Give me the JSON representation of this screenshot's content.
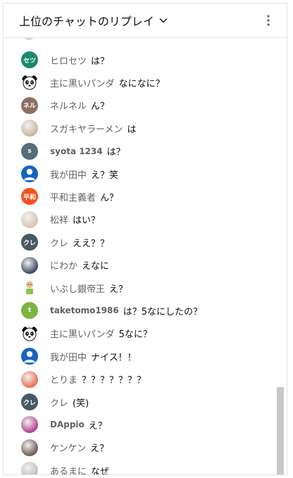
{
  "header": {
    "title": "上位のチャットのリプレイ"
  },
  "messages": [
    {
      "author": "ヒロセツ",
      "text": "は？",
      "avatar": {
        "kind": "initials",
        "label": "セツ",
        "color": "#1a8a6c"
      }
    },
    {
      "author": "主に黒いパンダ",
      "text": "なになに？",
      "avatar": {
        "kind": "panda-icon"
      }
    },
    {
      "author": "ネルネル",
      "text": "ん？",
      "avatar": {
        "kind": "initials",
        "label": "ネル",
        "color": "#8d6e63"
      }
    },
    {
      "author": "スガキヤラーメン",
      "text": "は",
      "avatar": {
        "kind": "photo",
        "color": "#c9b79a"
      }
    },
    {
      "author": "syota 1234",
      "text": "は？",
      "bold": true,
      "avatar": {
        "kind": "initials",
        "label": "s",
        "color": "#546e7a"
      }
    },
    {
      "author": "我が田中",
      "text": "え？笑",
      "avatar": {
        "kind": "person-icon",
        "color": "#1565c0"
      }
    },
    {
      "author": "平和主義者",
      "text": "ん？",
      "avatar": {
        "kind": "initials",
        "label": "平和",
        "color": "#f4511e"
      }
    },
    {
      "author": "松祥",
      "text": "はい？",
      "avatar": {
        "kind": "photo",
        "color": "#d7c4b0"
      }
    },
    {
      "author": "クレ",
      "text": "ええ？？",
      "avatar": {
        "kind": "initials",
        "label": "クレ",
        "color": "#455a64"
      }
    },
    {
      "author": "にわか",
      "text": "えなに",
      "avatar": {
        "kind": "photo",
        "color": "#3a4a63"
      }
    },
    {
      "author": "いぶし銀帝王",
      "text": "え？",
      "avatar": {
        "kind": "figure-icon",
        "color": "#e8c28a"
      }
    },
    {
      "author": "taketomo1986",
      "text": "は？5なにしたの？",
      "bold": true,
      "avatar": {
        "kind": "initials",
        "label": "t",
        "color": "#7cb342"
      }
    },
    {
      "author": "主に黒いパンダ",
      "text": "5なに？",
      "avatar": {
        "kind": "panda-icon"
      }
    },
    {
      "author": "我が田中",
      "text": "ナイス！！",
      "avatar": {
        "kind": "person-icon",
        "color": "#1565c0"
      }
    },
    {
      "author": "とりま",
      "text": "？？？？？？？",
      "avatar": {
        "kind": "photo",
        "color": "#e57357"
      }
    },
    {
      "author": "クレ",
      "text": "(笑)",
      "avatar": {
        "kind": "initials",
        "label": "クレ",
        "color": "#455a64"
      }
    },
    {
      "author": "DAppio",
      "text": "え？",
      "bold": true,
      "avatar": {
        "kind": "photo",
        "color": "#b0428f"
      }
    },
    {
      "author": "ケンケン",
      "text": "え？",
      "avatar": {
        "kind": "photo",
        "color": "#6b5b53"
      }
    },
    {
      "author": "あるまに",
      "text": "なぜ",
      "avatar": {
        "kind": "photo",
        "color": "#bdbdbd"
      }
    }
  ]
}
